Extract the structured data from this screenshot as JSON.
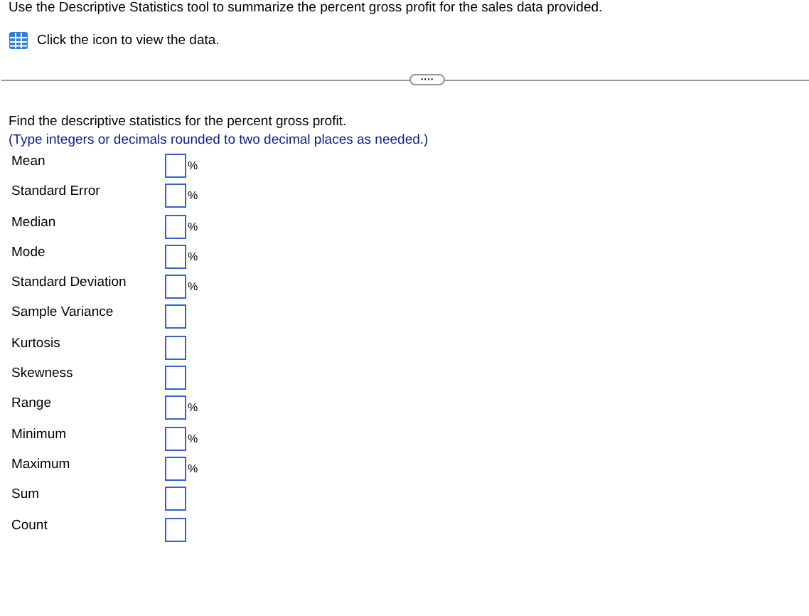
{
  "intro": "Use the Descriptive Statistics tool to summarize the percent gross profit for the sales data provided.",
  "data_link": "Click the icon to view the data.",
  "divider_handle": "····",
  "question": "Find the descriptive statistics for the percent gross profit.",
  "instruction": "(Type integers or decimals rounded to two decimal places as needed.)",
  "rows": [
    {
      "label": "Mean",
      "unit": "%"
    },
    {
      "label": "Standard Error",
      "unit": "%"
    },
    {
      "label": "Median",
      "unit": "%"
    },
    {
      "label": "Mode",
      "unit": "%"
    },
    {
      "label": "Standard Deviation",
      "unit": "%"
    },
    {
      "label": "Sample Variance"
    },
    {
      "label": "Kurtosis"
    },
    {
      "label": "Skewness"
    },
    {
      "label": "Range",
      "unit": "%"
    },
    {
      "label": "Minimum",
      "unit": "%"
    },
    {
      "label": "Maximum",
      "unit": "%"
    },
    {
      "label": "Sum"
    },
    {
      "label": "Count"
    }
  ]
}
